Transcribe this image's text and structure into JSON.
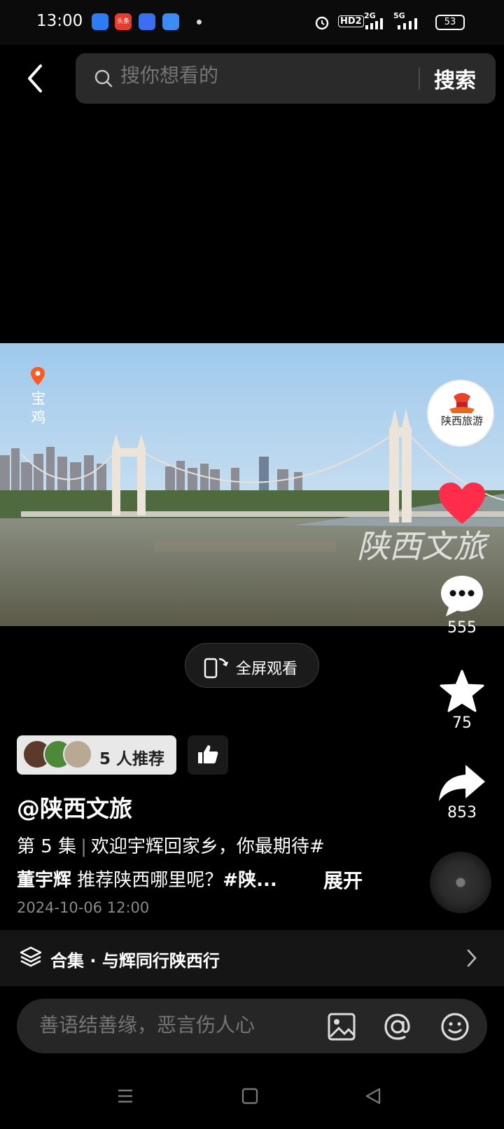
{
  "status_bar": {
    "time": "13:00",
    "app_icon_toutiao": "头条",
    "network": "HD2",
    "signal_2g": "2G",
    "signal_5g": "5G",
    "battery": "53"
  },
  "header": {
    "search_placeholder": "搜你想看的",
    "search_button": "搜索"
  },
  "video": {
    "location": "宝鸡",
    "watermark": "陕西文旅"
  },
  "author_avatar_text": "陕西旅游",
  "actions": {
    "comments": "555",
    "favorites": "75",
    "shares": "853",
    "like_color": "#ff2d4a"
  },
  "fullscreen_label": "全屏观看",
  "recommend": {
    "label": "5 人推荐"
  },
  "post": {
    "author": "@陕西文旅",
    "episode": "第 5 集",
    "line1": "欢迎宇辉回家乡，你最期待#",
    "line2_bold": "董宇辉",
    "line2_rest": " 推荐陕西哪里呢？",
    "line2_tag": "#陕...",
    "expand": "展开",
    "date": "2024-10-06 12:00"
  },
  "collection": {
    "label": "合集 · 与辉同行陕西行"
  },
  "comment": {
    "placeholder": "善语结善缘，恶言伤人心"
  }
}
